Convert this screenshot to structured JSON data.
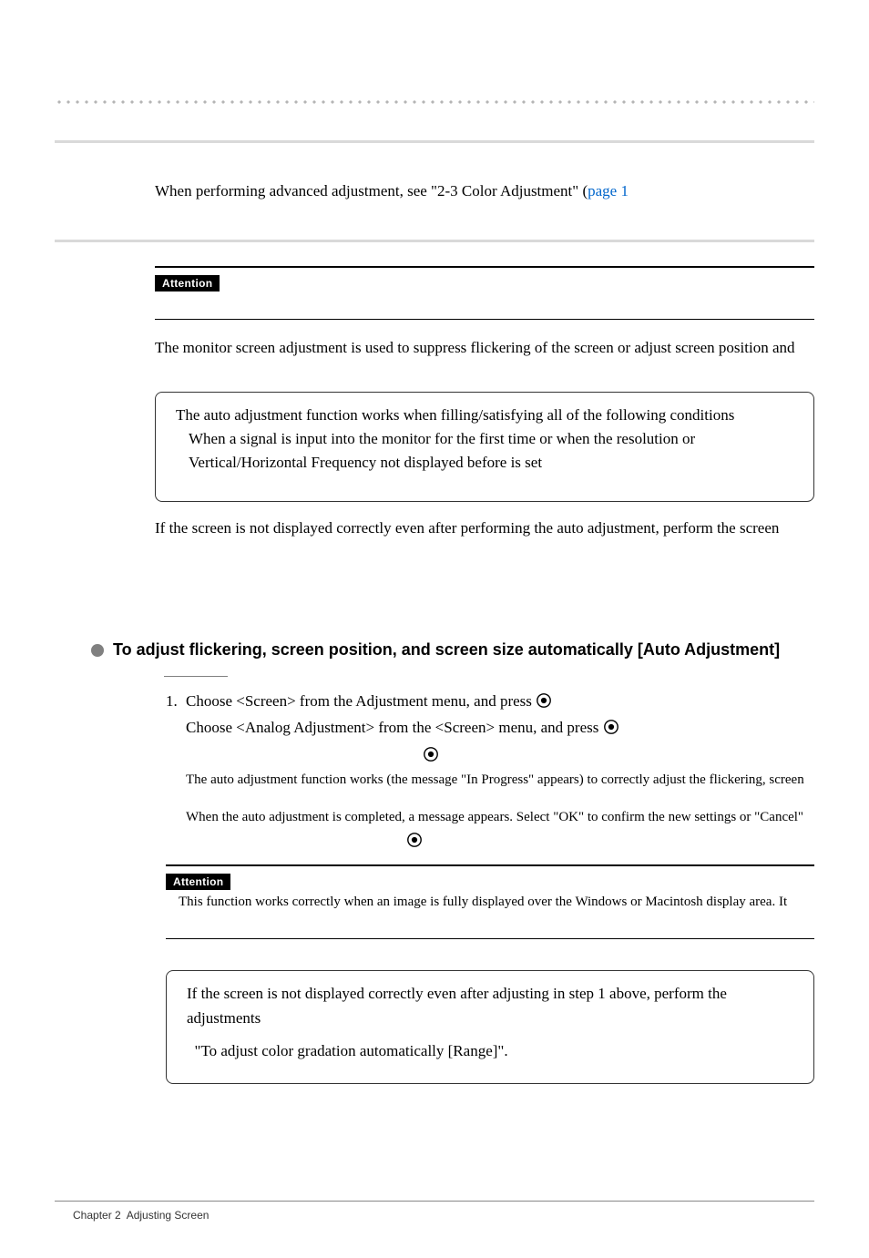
{
  "sec21": {
    "line1_pre": "When performing advanced adjustment, see \"2-3 Color Adjustment\" (",
    "link": "page 1",
    "line1_post": ""
  },
  "sec22": {
    "attention_label": "Attention",
    "intro": "The monitor screen adjustment is used to suppress flickering of the screen or adjust screen position and",
    "note_l1": "The auto adjustment function works when filling/satisfying all of the following conditions",
    "note_l2": "When a signal is input into the monitor for the first time or when the resolution or Vertical/Horizontal Frequency not displayed before is set",
    "after_note": "If the screen is not displayed correctly even after performing the auto adjustment, perform the screen"
  },
  "bullet": {
    "title": "To adjust flickering, screen position, and screen size automatically [Auto Adjustment]"
  },
  "proc": {
    "step1_num": "1.",
    "step1_l1": "Choose <Screen> from the Adjustment menu, and press ",
    "step1_l2": "Choose <Analog Adjustment> from the <Screen> menu, and press ",
    "step1_msg1": "The auto adjustment function works (the message \"In Progress\" appears) to correctly adjust the flickering, screen",
    "step1_msg2": "When the auto adjustment is completed, a message appears. Select \"OK\" to confirm the new settings or \"Cancel\"",
    "attention_label": "Attention",
    "attention_text": "This function works correctly when an image is fully displayed over the Windows or Macintosh display area. It",
    "box_l1": "If the screen is not displayed correctly even after adjusting in step 1 above, perform the adjustments",
    "box_l2": "  \"To adjust color gradation automatically [Range]\"."
  },
  "footer": {
    "text": "Chapter 2 Adjusting Screen"
  }
}
